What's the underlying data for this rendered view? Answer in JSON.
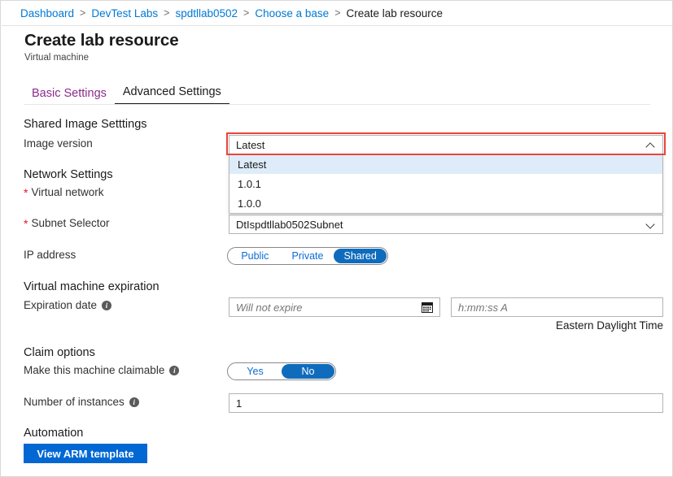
{
  "breadcrumb": {
    "items": [
      {
        "label": "Dashboard",
        "current": false
      },
      {
        "label": "DevTest Labs",
        "current": false
      },
      {
        "label": "spdtllab0502",
        "current": false
      },
      {
        "label": "Choose a base",
        "current": false
      },
      {
        "label": "Create lab resource",
        "current": true
      }
    ],
    "separator": ">"
  },
  "header": {
    "title": "Create lab resource",
    "subtitle": "Virtual machine"
  },
  "tabs": [
    {
      "label": "Basic Settings",
      "active": false
    },
    {
      "label": "Advanced Settings",
      "active": true
    }
  ],
  "sections": {
    "shared_image": {
      "heading": "Shared Image Setttings",
      "image_version": {
        "label": "Image version",
        "value": "Latest",
        "expanded": true,
        "chevron": "chevron-up-icon",
        "options": [
          {
            "label": "Latest",
            "selected": true
          },
          {
            "label": "1.0.1",
            "selected": false
          },
          {
            "label": "1.0.0",
            "selected": false
          }
        ]
      }
    },
    "network": {
      "heading": "Network Settings",
      "virtual_network": {
        "label": "Virtual network",
        "required_marker": "*"
      },
      "subnet_selector": {
        "label": "Subnet Selector",
        "required_marker": "*",
        "value": "DtIspdtllab0502Subnet",
        "chevron": "chevron-down-icon"
      },
      "ip_address": {
        "label": "IP address",
        "options": [
          {
            "label": "Public",
            "selected": false
          },
          {
            "label": "Private",
            "selected": false
          },
          {
            "label": "Shared",
            "selected": true
          }
        ]
      }
    },
    "expiration": {
      "heading": "Virtual machine expiration",
      "expiration_date": {
        "label": "Expiration date",
        "info": "info-icon",
        "date_placeholder": "Will not expire",
        "date_value": "",
        "calendar_icon": "calendar-icon",
        "time_placeholder": "h:mm:ss A",
        "time_value": "",
        "timezone_note": "Eastern Daylight Time"
      }
    },
    "claim": {
      "heading": "Claim options",
      "claimable": {
        "label": "Make this machine claimable",
        "info": "info-icon",
        "options": [
          {
            "label": "Yes",
            "selected": false
          },
          {
            "label": "No",
            "selected": true
          }
        ]
      },
      "instances": {
        "label": "Number of instances",
        "info": "info-icon",
        "value": "1"
      }
    },
    "automation": {
      "heading": "Automation",
      "view_arm_template_label": "View ARM template"
    }
  },
  "colors": {
    "link_blue": "#0078d4",
    "tab_inactive_purple": "#8a2b8a",
    "accent_blue": "#0f6cbd",
    "button_blue": "#0067d3",
    "required_red": "#e81123",
    "annotation_red": "#e8453c",
    "dropdown_highlight": "#deecf9"
  }
}
